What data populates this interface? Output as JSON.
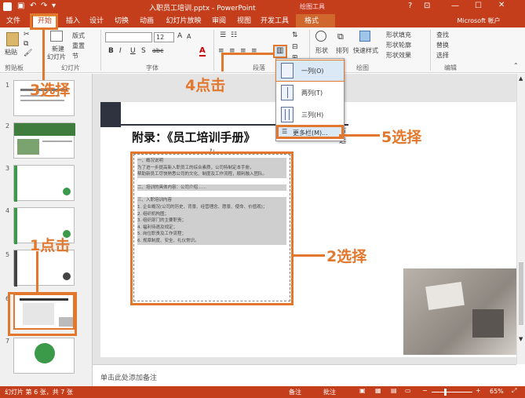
{
  "app": {
    "document_title": "入职员工培训.pptx - PowerPoint",
    "context_group": "绘图工具",
    "account": "Microsoft 帐户",
    "help": "?"
  },
  "tabs": [
    "文件",
    "开始",
    "插入",
    "设计",
    "切换",
    "动画",
    "幻灯片放映",
    "审阅",
    "视图",
    "开发工具",
    "格式"
  ],
  "ribbon": {
    "clipboard": {
      "paste": "粘贴",
      "group": "剪贴板"
    },
    "slides": {
      "new_slide_1": "新建",
      "new_slide_2": "幻灯片",
      "layout": "版式",
      "reset": "重置",
      "section": "节",
      "group": "幻灯片"
    },
    "font": {
      "size": "12",
      "bold": "B",
      "italic": "I",
      "underline": "U",
      "shadow": "S",
      "strike": "abc",
      "group": "字体"
    },
    "paragraph": {
      "group": "段落",
      "direction_1": "文字方向",
      "align_1": "对齐文本",
      "smartart_1": "转换为 SmartArt"
    },
    "drawing": {
      "shapes": "形状",
      "arrange": "排列",
      "quick_styles": "快速样式",
      "fill": "形状填充",
      "outline": "形状轮廓",
      "effects": "形状效果",
      "group": "绘图"
    },
    "editing": {
      "find": "查找",
      "replace": "替换",
      "select": "选择",
      "group": "编辑"
    }
  },
  "columns_menu": {
    "items": [
      "一列(O)",
      "两列(T)",
      "三列(H)"
    ],
    "more": "更多栏(M)..."
  },
  "slide": {
    "title": "附录：《员工培训手册》",
    "title_tail_1": "节",
    "title_tail_2": "选",
    "paragraphs": [
      "一、概况说明",
      "为了进一步提高新入职员工的综合素质，公司特制定本手册，",
      "帮助新员工尽快熟悉公司的文化、制度及工作流程，顺利融入团队。",
      "二、培训的具体内容：公司介绍……",
      "三、入职培训内容",
      "1. 企业概况(公司的历史、背景、经营理念、愿景、使命、价值观)；",
      "2. 组织机构图；",
      "3. 组织部门的主要职责；",
      "4. 福利待遇及规定；",
      "5. 岗位职责及工作流程；",
      "6. 规章制度、安全、礼仪常识。"
    ]
  },
  "thumbnails": [
    "1",
    "2",
    "3",
    "4",
    "5",
    "6",
    "7"
  ],
  "notes_placeholder": "单击此处添加备注",
  "status": {
    "slide_info": "幻灯片 第 6 张，共 7 张",
    "notes": "备注",
    "comments": "批注",
    "zoom": "65%"
  },
  "callouts": {
    "c1": "1点击",
    "c2": "2选择",
    "c3": "3选择",
    "c4": "4点击",
    "c5": "5选择"
  },
  "colors": {
    "accent": "#c43e1c",
    "callout": "#e2782e"
  }
}
